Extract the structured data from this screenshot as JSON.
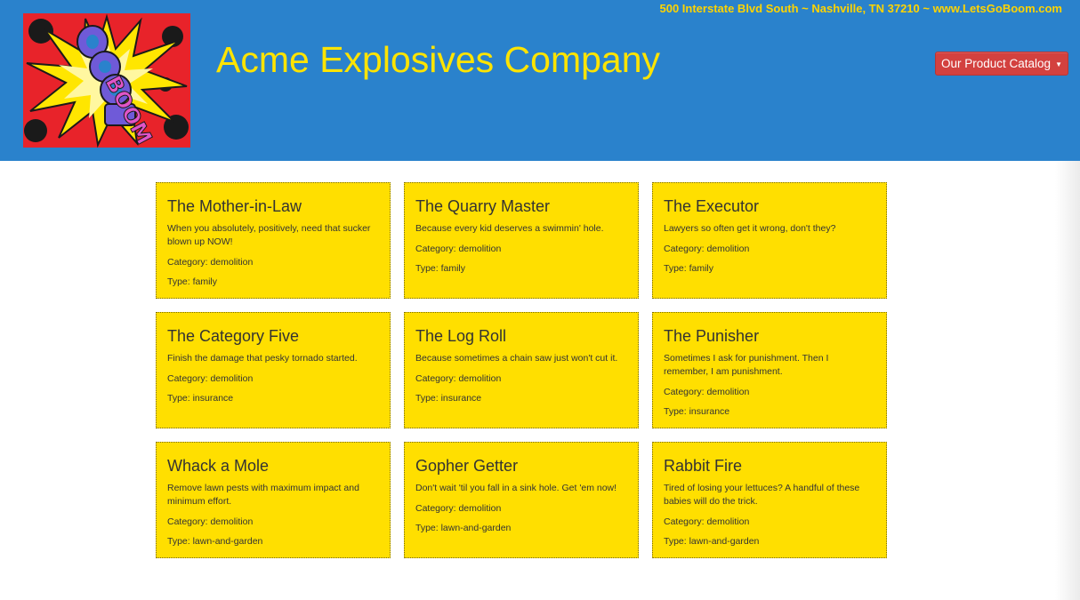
{
  "header": {
    "address": "500 Interstate Blvd South ~ Nashville, TN 37210 ~ www.LetsGoBoom.com",
    "logo_text": "BOOM",
    "title": "Acme Explosives Company",
    "catalog_button": "Our Product Catalog"
  },
  "colors": {
    "header_bg": "#2a82cc",
    "title": "#ffe400",
    "card_bg": "#ffdf00",
    "button": "#d3413f"
  },
  "products": [
    {
      "title": "The Mother-in-Law",
      "description": "When you absolutely, positively, need that sucker blown up NOW!",
      "category": "Category: demolition",
      "type": "Type: family"
    },
    {
      "title": "The Quarry Master",
      "description": "Because every kid deserves a swimmin' hole.",
      "category": "Category: demolition",
      "type": "Type: family"
    },
    {
      "title": "The Executor",
      "description": "Lawyers so often get it wrong, don't they?",
      "category": "Category: demolition",
      "type": "Type: family"
    },
    {
      "title": "The Category Five",
      "description": "Finish the damage that pesky tornado started.",
      "category": "Category: demolition",
      "type": "Type: insurance"
    },
    {
      "title": "The Log Roll",
      "description": "Because sometimes a chain saw just won't cut it.",
      "category": "Category: demolition",
      "type": "Type: insurance"
    },
    {
      "title": "The Punisher",
      "description": "Sometimes I ask for punishment. Then I remember, I am punishment.",
      "category": "Category: demolition",
      "type": "Type: insurance"
    },
    {
      "title": "Whack a Mole",
      "description": "Remove lawn pests with maximum impact and minimum effort.",
      "category": "Category: demolition",
      "type": "Type: lawn-and-garden"
    },
    {
      "title": "Gopher Getter",
      "description": "Don't wait 'til you fall in a sink hole. Get 'em now!",
      "category": "Category: demolition",
      "type": "Type: lawn-and-garden"
    },
    {
      "title": "Rabbit Fire",
      "description": "Tired of losing your lettuces? A handful of these babies will do the trick.",
      "category": "Category: demolition",
      "type": "Type: lawn-and-garden"
    }
  ]
}
